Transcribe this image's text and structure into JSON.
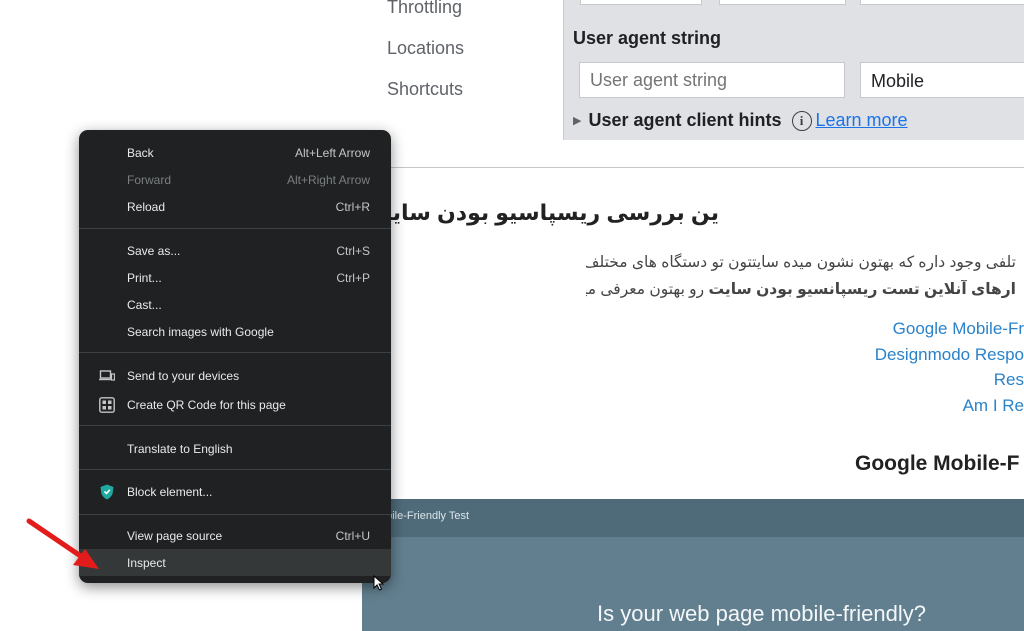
{
  "settings_nav": [
    "Throttling",
    "Locations",
    "Shortcuts"
  ],
  "device_settings": {
    "ua_heading": "User agent string",
    "ua_placeholder": "User agent string",
    "device_select": "Mobile",
    "client_hints": "User agent client hints",
    "learn_more": "Learn more"
  },
  "article": {
    "heading": "ین بررسی ریسپاسیو بودن سایت",
    "para1": "تلفی وجود داره که بهتون نشون میده سایتتون تو دستگاه های مختلف چه شکلی میشن. در ا",
    "para2_bold": "ارهای آنلاین تست ریسپانسیو بودن سایت",
    "para2_rest": " رو بهتون معرفی میکنیم.",
    "links": [
      "Google Mobile-Fr",
      "Designmodo Respo",
      "Res",
      "Am I Re"
    ],
    "subheading": "Google Mobile-F"
  },
  "embed": {
    "bar_text": "obile-Friendly Test",
    "title": "Is your web page mobile-friendly?",
    "color": "#627f8f"
  },
  "context_menu": {
    "back": {
      "label": "Back",
      "shortcut": "Alt+Left Arrow"
    },
    "forward": {
      "label": "Forward",
      "shortcut": "Alt+Right Arrow"
    },
    "reload": {
      "label": "Reload",
      "shortcut": "Ctrl+R"
    },
    "save_as": {
      "label": "Save as...",
      "shortcut": "Ctrl+S"
    },
    "print": {
      "label": "Print...",
      "shortcut": "Ctrl+P"
    },
    "cast": {
      "label": "Cast..."
    },
    "search_images": {
      "label": "Search images with Google"
    },
    "send_devices": {
      "label": "Send to your devices",
      "icon": "devices-icon"
    },
    "qr_code": {
      "label": "Create QR Code for this page",
      "icon": "qr-code-icon"
    },
    "translate": {
      "label": "Translate to English"
    },
    "block_element": {
      "label": "Block element...",
      "icon": "adblock-shield-icon"
    },
    "view_source": {
      "label": "View page source",
      "shortcut": "Ctrl+U"
    },
    "inspect": {
      "label": "Inspect"
    }
  },
  "colors": {
    "menu_bg": "#1f2122",
    "menu_hover": "#353839",
    "link_blue": "#2a82c9",
    "arrow_red": "#e31b1b"
  }
}
